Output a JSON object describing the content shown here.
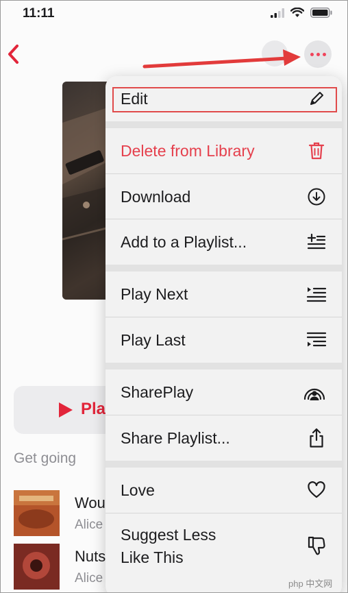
{
  "status_bar": {
    "time": "11:11"
  },
  "header": {
    "back_icon": "chevron-left-icon",
    "more_icon": "ellipsis-icon"
  },
  "playlist": {
    "play_label": "Pla",
    "section_label": "Get going",
    "songs": [
      {
        "title": "Wou",
        "artist": "Alice"
      },
      {
        "title": "Nuts",
        "artist": "Alice in Chains"
      }
    ]
  },
  "menu": {
    "items": [
      {
        "label": "Edit",
        "icon": "pencil-icon"
      },
      {
        "label": "Delete from Library",
        "icon": "trash-icon",
        "color": "#e5404d"
      },
      {
        "label": "Download",
        "icon": "download-circle-icon"
      },
      {
        "label": "Add to a Playlist...",
        "icon": "add-to-list-icon"
      },
      {
        "label": "Play Next",
        "icon": "play-next-icon"
      },
      {
        "label": "Play Last",
        "icon": "play-last-icon"
      },
      {
        "label": "SharePlay",
        "icon": "shareplay-icon"
      },
      {
        "label": "Share Playlist...",
        "icon": "share-icon"
      },
      {
        "label": "Love",
        "icon": "heart-icon"
      },
      {
        "label": "Suggest Less",
        "label2": "Like This",
        "icon": "thumbs-down-icon"
      }
    ]
  },
  "annotation": {
    "highlight_color": "#e04a4a",
    "arrow_color": "#e23b3b"
  },
  "watermark": {
    "text": "php 中文网"
  }
}
